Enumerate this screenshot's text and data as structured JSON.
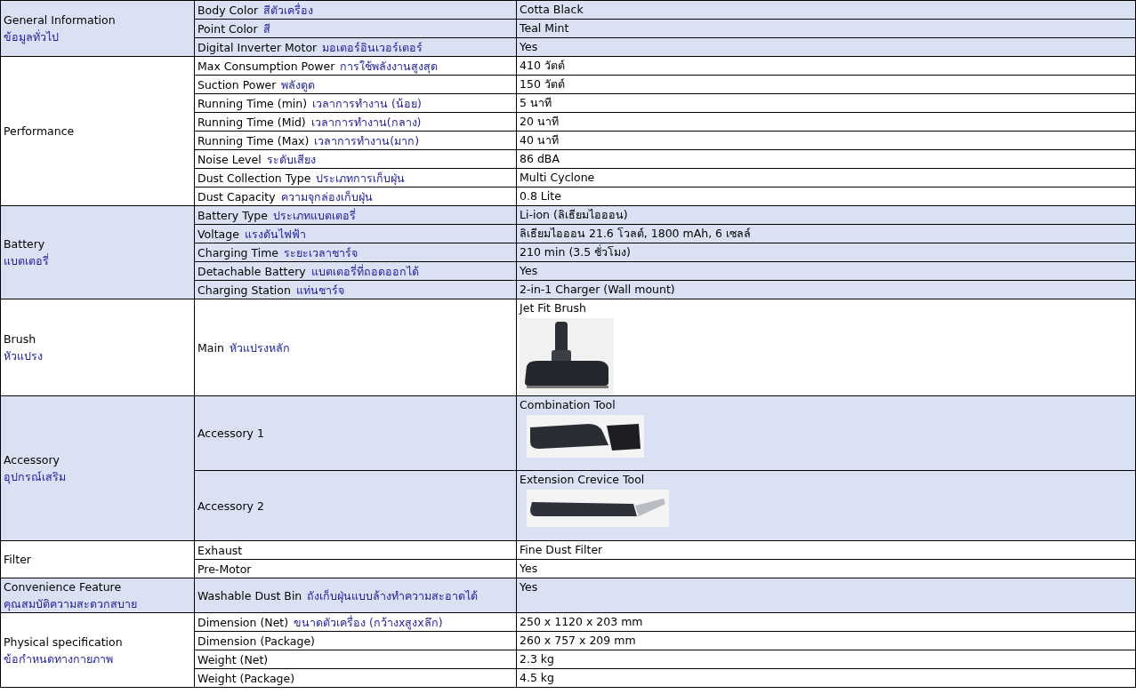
{
  "groups": [
    {
      "name": "General Information",
      "thai": "ข้อมูลทั่วไป",
      "rows": [
        {
          "label": "Body Color",
          "thai": "สีตัวเครื่อง",
          "kind": "text",
          "value": "Cotta Black"
        },
        {
          "label": "Point Color",
          "thai": "สี",
          "kind": "text",
          "value": "Teal Mint"
        },
        {
          "label": "Digital Inverter Motor",
          "thai": "มอเตอร์อินเวอร์เตอร์",
          "kind": "text",
          "value": "Yes"
        }
      ]
    },
    {
      "name": "Performance",
      "rows": [
        {
          "label": "Max Consumption Power",
          "thai": "การใช้พลังงานสูงสุด",
          "kind": "text",
          "value": "410 วัตต์"
        },
        {
          "label": "Suction Power",
          "thai": "พลังดูด",
          "kind": "text",
          "value": "150 วัตต์"
        },
        {
          "label": "Running Time (min)",
          "thai": "เวลาการทำงาน (น้อย)",
          "kind": "text",
          "value": "5 นาที"
        },
        {
          "label": "Running Time (Mid)",
          "thai": "เวลาการทำงาน(กลาง)",
          "kind": "text",
          "value": "20 นาที"
        },
        {
          "label": "Running Time (Max)",
          "thai": "เวลาการทำงาน(มาก)",
          "kind": "text",
          "value": "40 นาที"
        },
        {
          "label": "Noise Level",
          "thai": "ระดับเสียง",
          "kind": "text",
          "value": "86 dBA"
        },
        {
          "label": "Dust Collection Type",
          "thai": "ประเภทการเก็บฝุ่น",
          "kind": "text",
          "value": "Multi Cyclone"
        },
        {
          "label": "Dust Capacity",
          "thai": "ความจุกล่องเก็บฝุ่น",
          "kind": "text",
          "value": "0.8 Lite"
        }
      ]
    },
    {
      "name": "Battery",
      "thai": "แบตเตอรี่",
      "rows": [
        {
          "label": "Battery Type",
          "thai": "ประเภทแบตเตอรี่",
          "kind": "text",
          "value": "Li-ion (ลิเธียมไอออน)"
        },
        {
          "label": "Voltage",
          "thai": "แรงดันไฟฟ้า",
          "kind": "text",
          "value": "ลิเธียมไอออน 21.6 โวลต์, 1800 mAh, 6 เซลล์"
        },
        {
          "label": "Charging Time",
          "thai": "ระยะเวลาชาร์จ",
          "kind": "text",
          "value": "210 min (3.5 ชั่วโมง)"
        },
        {
          "label": "Detachable Battery",
          "thai": "แบตเตอรี่ที่ถอดออกได้",
          "kind": "text",
          "value": "Yes"
        },
        {
          "label": "Charging Station",
          "thai": "แท่นชาร์จ",
          "kind": "text",
          "value": "2-in-1 Charger (Wall mount)"
        }
      ]
    },
    {
      "name": "Brush",
      "thai": "หัวแปรง",
      "rows": [
        {
          "label": "Main",
          "thai": "หัวแปรงหลัก",
          "kind": "brush",
          "value": "Jet Fit Brush"
        }
      ]
    },
    {
      "name": "Accessory",
      "thai": "อุปกรณ์เสริม",
      "rows": [
        {
          "label": "Accessory 1",
          "kind": "combo",
          "value": "Combination Tool"
        },
        {
          "label": "Accessory 2",
          "kind": "crevice",
          "value": "Extension Crevice Tool"
        }
      ]
    },
    {
      "name": "Filter",
      "rows": [
        {
          "label": "Exhaust",
          "kind": "text",
          "value": "Fine Dust Filter"
        },
        {
          "label": "Pre-Motor",
          "kind": "text",
          "value": "Yes"
        }
      ]
    },
    {
      "name": "Convenience Feature",
      "thai": "คุณสมบัติความสะดวกสบาย",
      "rows": [
        {
          "label": "Washable Dust Bin",
          "thai": "ถังเก็บฝุ่นแบบล้างทำความสะอาดได้",
          "kind": "text",
          "value": "Yes"
        }
      ]
    },
    {
      "name": "Physical specification",
      "thai": "ข้อกำหนดทางกายภาพ",
      "rows": [
        {
          "label": "Dimension (Net)",
          "thai": "ขนาดตัวเครื่อง (กว้างxสูงxลึก)",
          "kind": "text",
          "value": "250 x 1120 x 203 mm"
        },
        {
          "label": "Dimension (Package)",
          "kind": "text",
          "value": "260 x 757 x 209 mm"
        },
        {
          "label": "Weight (Net)",
          "kind": "text",
          "value": "2.3 kg"
        },
        {
          "label": "Weight (Package)",
          "kind": "text",
          "value": "4.5 kg"
        }
      ]
    }
  ]
}
